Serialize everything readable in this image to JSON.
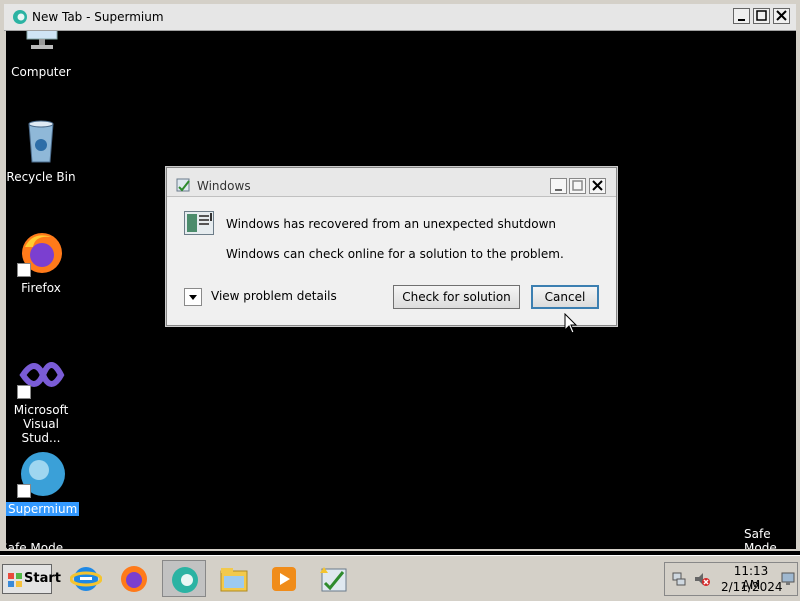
{
  "window": {
    "title": "New Tab - Supermium"
  },
  "desktop": {
    "icons": [
      {
        "label": "Computer",
        "icon": "computer-icon"
      },
      {
        "label": "Recycle Bin",
        "icon": "recycle-bin-icon"
      },
      {
        "label": "Firefox",
        "icon": "firefox-icon"
      },
      {
        "label": "Microsoft Visual Stud...",
        "icon": "visual-studio-icon"
      },
      {
        "label": "Supermium",
        "icon": "supermium-icon"
      }
    ],
    "safe_mode_left": "Safe Mode",
    "safe_mode_right": "Safe Mode"
  },
  "dialog": {
    "title": "Windows",
    "message": "Windows has recovered from an unexpected shutdown",
    "submessage": "Windows can check online for a solution to the problem.",
    "details_label": "View problem details",
    "check_button": "Check for solution",
    "cancel_button": "Cancel"
  },
  "taskbar": {
    "start_label": "Start",
    "apps": [
      "internet-explorer-icon",
      "firefox-icon",
      "supermium-icon",
      "file-explorer-icon",
      "media-player-icon",
      "windows-tools-icon"
    ],
    "clock": {
      "time": "11:13 AM",
      "date": "2/11/2024"
    }
  },
  "colors": {
    "selection": "#3399ff",
    "desktop": "#000000",
    "taskbar": "#d4d0c8"
  }
}
